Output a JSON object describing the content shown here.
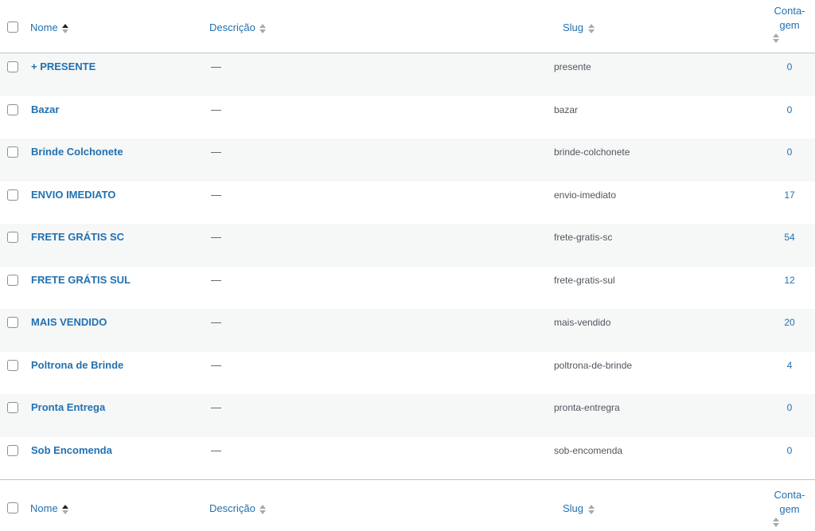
{
  "columns": {
    "name": "Nome",
    "description": "Descrição",
    "slug": "Slug",
    "count_line1": "Conta-",
    "count_line2": "gem"
  },
  "rows": [
    {
      "name": "+ PRESENTE",
      "description": "—",
      "slug": "presente",
      "count": "0"
    },
    {
      "name": "Bazar",
      "description": "—",
      "slug": "bazar",
      "count": "0"
    },
    {
      "name": "Brinde Colchonete",
      "description": "—",
      "slug": "brinde-colchonete",
      "count": "0"
    },
    {
      "name": "ENVIO IMEDIATO",
      "description": "—",
      "slug": "envio-imediato",
      "count": "17"
    },
    {
      "name": "FRETE GRÁTIS SC",
      "description": "—",
      "slug": "frete-gratis-sc",
      "count": "54"
    },
    {
      "name": "FRETE GRÁTIS SUL",
      "description": "—",
      "slug": "frete-gratis-sul",
      "count": "12"
    },
    {
      "name": "MAIS VENDIDO",
      "description": "—",
      "slug": "mais-vendido",
      "count": "20"
    },
    {
      "name": "Poltrona de Brinde",
      "description": "—",
      "slug": "poltrona-de-brinde",
      "count": "4"
    },
    {
      "name": "Pronta Entrega",
      "description": "—",
      "slug": "pronta-entregra",
      "count": "0"
    },
    {
      "name": "Sob Encomenda",
      "description": "—",
      "slug": "sob-encomenda",
      "count": "0"
    }
  ],
  "colors": {
    "link": "#2271b1",
    "alt_row": "#f6f7f7"
  }
}
